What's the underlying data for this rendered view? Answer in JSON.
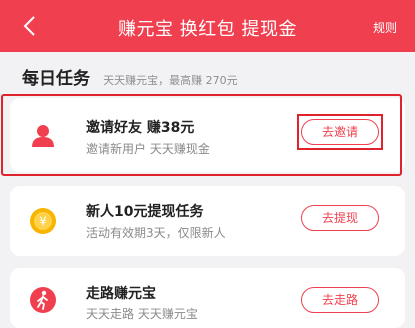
{
  "header": {
    "title": "赚元宝 换红包 提现金",
    "rules_label": "规则",
    "back_icon": "chevron-left-icon"
  },
  "section": {
    "title": "每日任务",
    "subtitle": "天天赚元宝，最高赚 270元"
  },
  "tasks": [
    {
      "title": "邀请好友 赚38元",
      "subtitle": "邀请新用户 天天赚现金",
      "button": "去邀请",
      "icon": "person-icon",
      "highlighted": true
    },
    {
      "title": "新人10元提现任务",
      "subtitle": "活动有效期3天，仅限新人",
      "button": "去提现",
      "icon": "yuan-coin-icon",
      "highlighted": false
    },
    {
      "title": "走路赚元宝",
      "subtitle": "天天走路 天天赚元宝",
      "button": "去走路",
      "icon": "walking-icon",
      "highlighted": false
    }
  ],
  "colors": {
    "accent": "#f0404f",
    "highlight": "#e0222c",
    "coin": "#f7b500"
  }
}
